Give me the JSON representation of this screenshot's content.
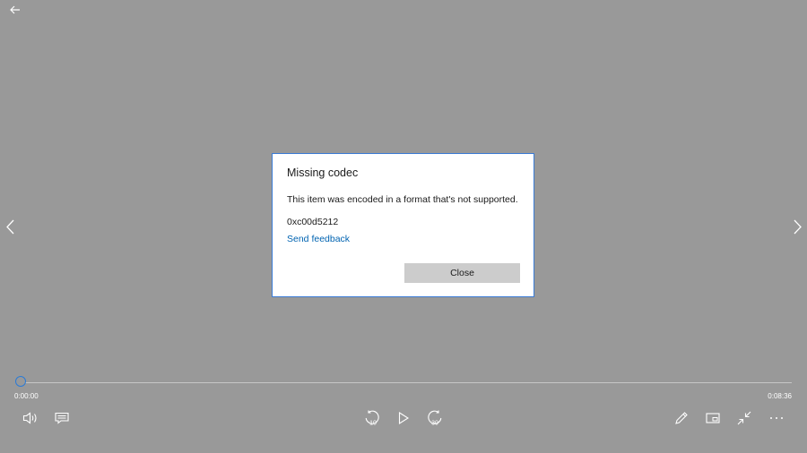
{
  "window": {
    "back_icon": "back-arrow-icon"
  },
  "navigation": {
    "previous_icon": "chevron-left-icon",
    "next_icon": "chevron-right-icon"
  },
  "dialog": {
    "title": "Missing codec",
    "message": "This item was encoded in a format that's not supported.",
    "error_code": "0xc00d5212",
    "link_label": "Send feedback",
    "close_label": "Close",
    "accent_color": "#3a7bd5",
    "link_color": "#0063b1"
  },
  "player": {
    "current_time": "0:00:00",
    "total_time": "0:08:36",
    "progress": 0,
    "skip_back_seconds": "10",
    "skip_forward_seconds": "30",
    "controls_left": [
      "volume-icon",
      "subtitles-icon"
    ],
    "controls_center": [
      "skip-back-10-icon",
      "play-icon",
      "skip-forward-30-icon"
    ],
    "controls_right": [
      "edit-pen-icon",
      "mini-view-icon",
      "exit-fullscreen-icon",
      "more-options-icon"
    ]
  }
}
